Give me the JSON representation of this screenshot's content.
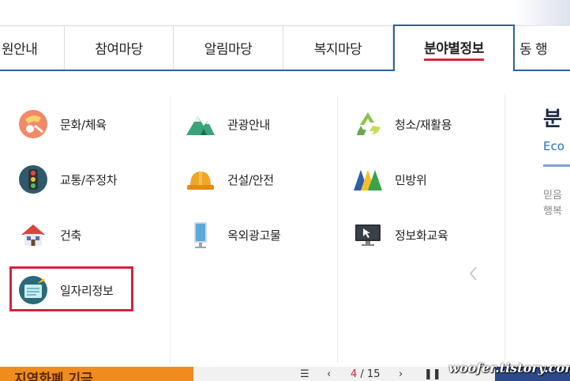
{
  "nav": {
    "tabs": [
      {
        "label": "원안내"
      },
      {
        "label": "참여마당"
      },
      {
        "label": "알림마당"
      },
      {
        "label": "복지마당"
      },
      {
        "label": "분야별정보"
      },
      {
        "label": "동 행"
      }
    ],
    "active_index": 4
  },
  "menu": {
    "col1": [
      {
        "label": "문화/체육",
        "icon": "culture-sports-icon"
      },
      {
        "label": "교통/주정차",
        "icon": "traffic-light-icon"
      },
      {
        "label": "건축",
        "icon": "house-icon"
      },
      {
        "label": "일자리정보",
        "icon": "job-info-icon"
      }
    ],
    "col2": [
      {
        "label": "관광안내",
        "icon": "mountain-icon"
      },
      {
        "label": "건설/안전",
        "icon": "hard-hat-icon"
      },
      {
        "label": "옥외광고물",
        "icon": "billboard-icon"
      }
    ],
    "col3": [
      {
        "label": "청소/재활용",
        "icon": "recycle-icon"
      },
      {
        "label": "민방위",
        "icon": "civil-defense-icon"
      },
      {
        "label": "정보화교육",
        "icon": "monitor-icon"
      }
    ]
  },
  "side": {
    "title": "분",
    "subtitle": "Eco",
    "line1": "믿음",
    "line2": "행복"
  },
  "footer": {
    "banner_text": "지역화폐 기금",
    "page_current": "4",
    "page_total": "/ 15"
  },
  "watermark": "woofer.tistory.com",
  "colors": {
    "nav_border": "#2f5fa7",
    "active_underline": "#d7263d",
    "highlight_box": "#d0243f"
  }
}
